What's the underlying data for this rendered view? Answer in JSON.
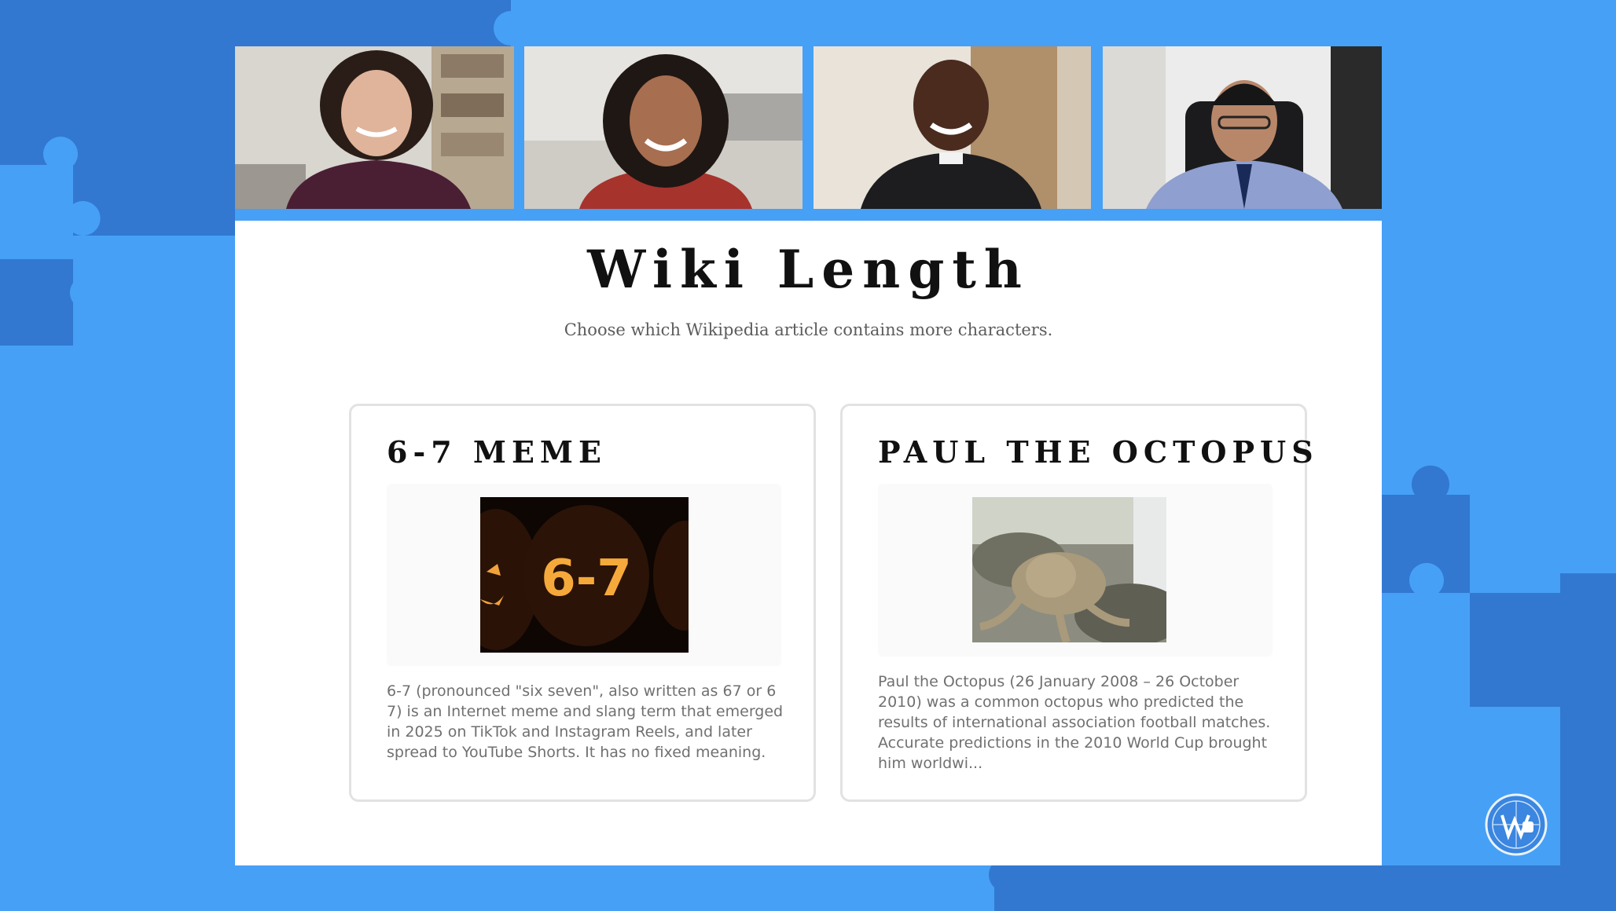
{
  "slide": {
    "title": "Wiki Length",
    "subtitle": "Choose which Wikipedia article contains more characters."
  },
  "cards": [
    {
      "heading": "6-7 MEME",
      "image_text": "6-7",
      "description": "6-7 (pronounced \"six seven\", also written as 67 or 6 7) is an Internet meme and slang term that emerged in 2025 on TikTok and Instagram Reels, and later spread to YouTube Shorts. It has no fixed meaning."
    },
    {
      "heading": "PAUL THE OCTOPUS",
      "description": "Paul the Octopus (26 January 2008 – 26 October 2010) was a common octopus who predicted the results of international association football matches. Accurate predictions in the 2010 World Cup brought him worldwi..."
    }
  ],
  "participants": [
    {
      "name": "participant-1"
    },
    {
      "name": "participant-2"
    },
    {
      "name": "participant-3"
    },
    {
      "name": "participant-4"
    }
  ],
  "colors": {
    "background": "#46a0f6",
    "puzzle_dark": "#2f74cc",
    "panel": "#ffffff"
  },
  "icons": {
    "logo": "wikipedia-globe-icon"
  }
}
